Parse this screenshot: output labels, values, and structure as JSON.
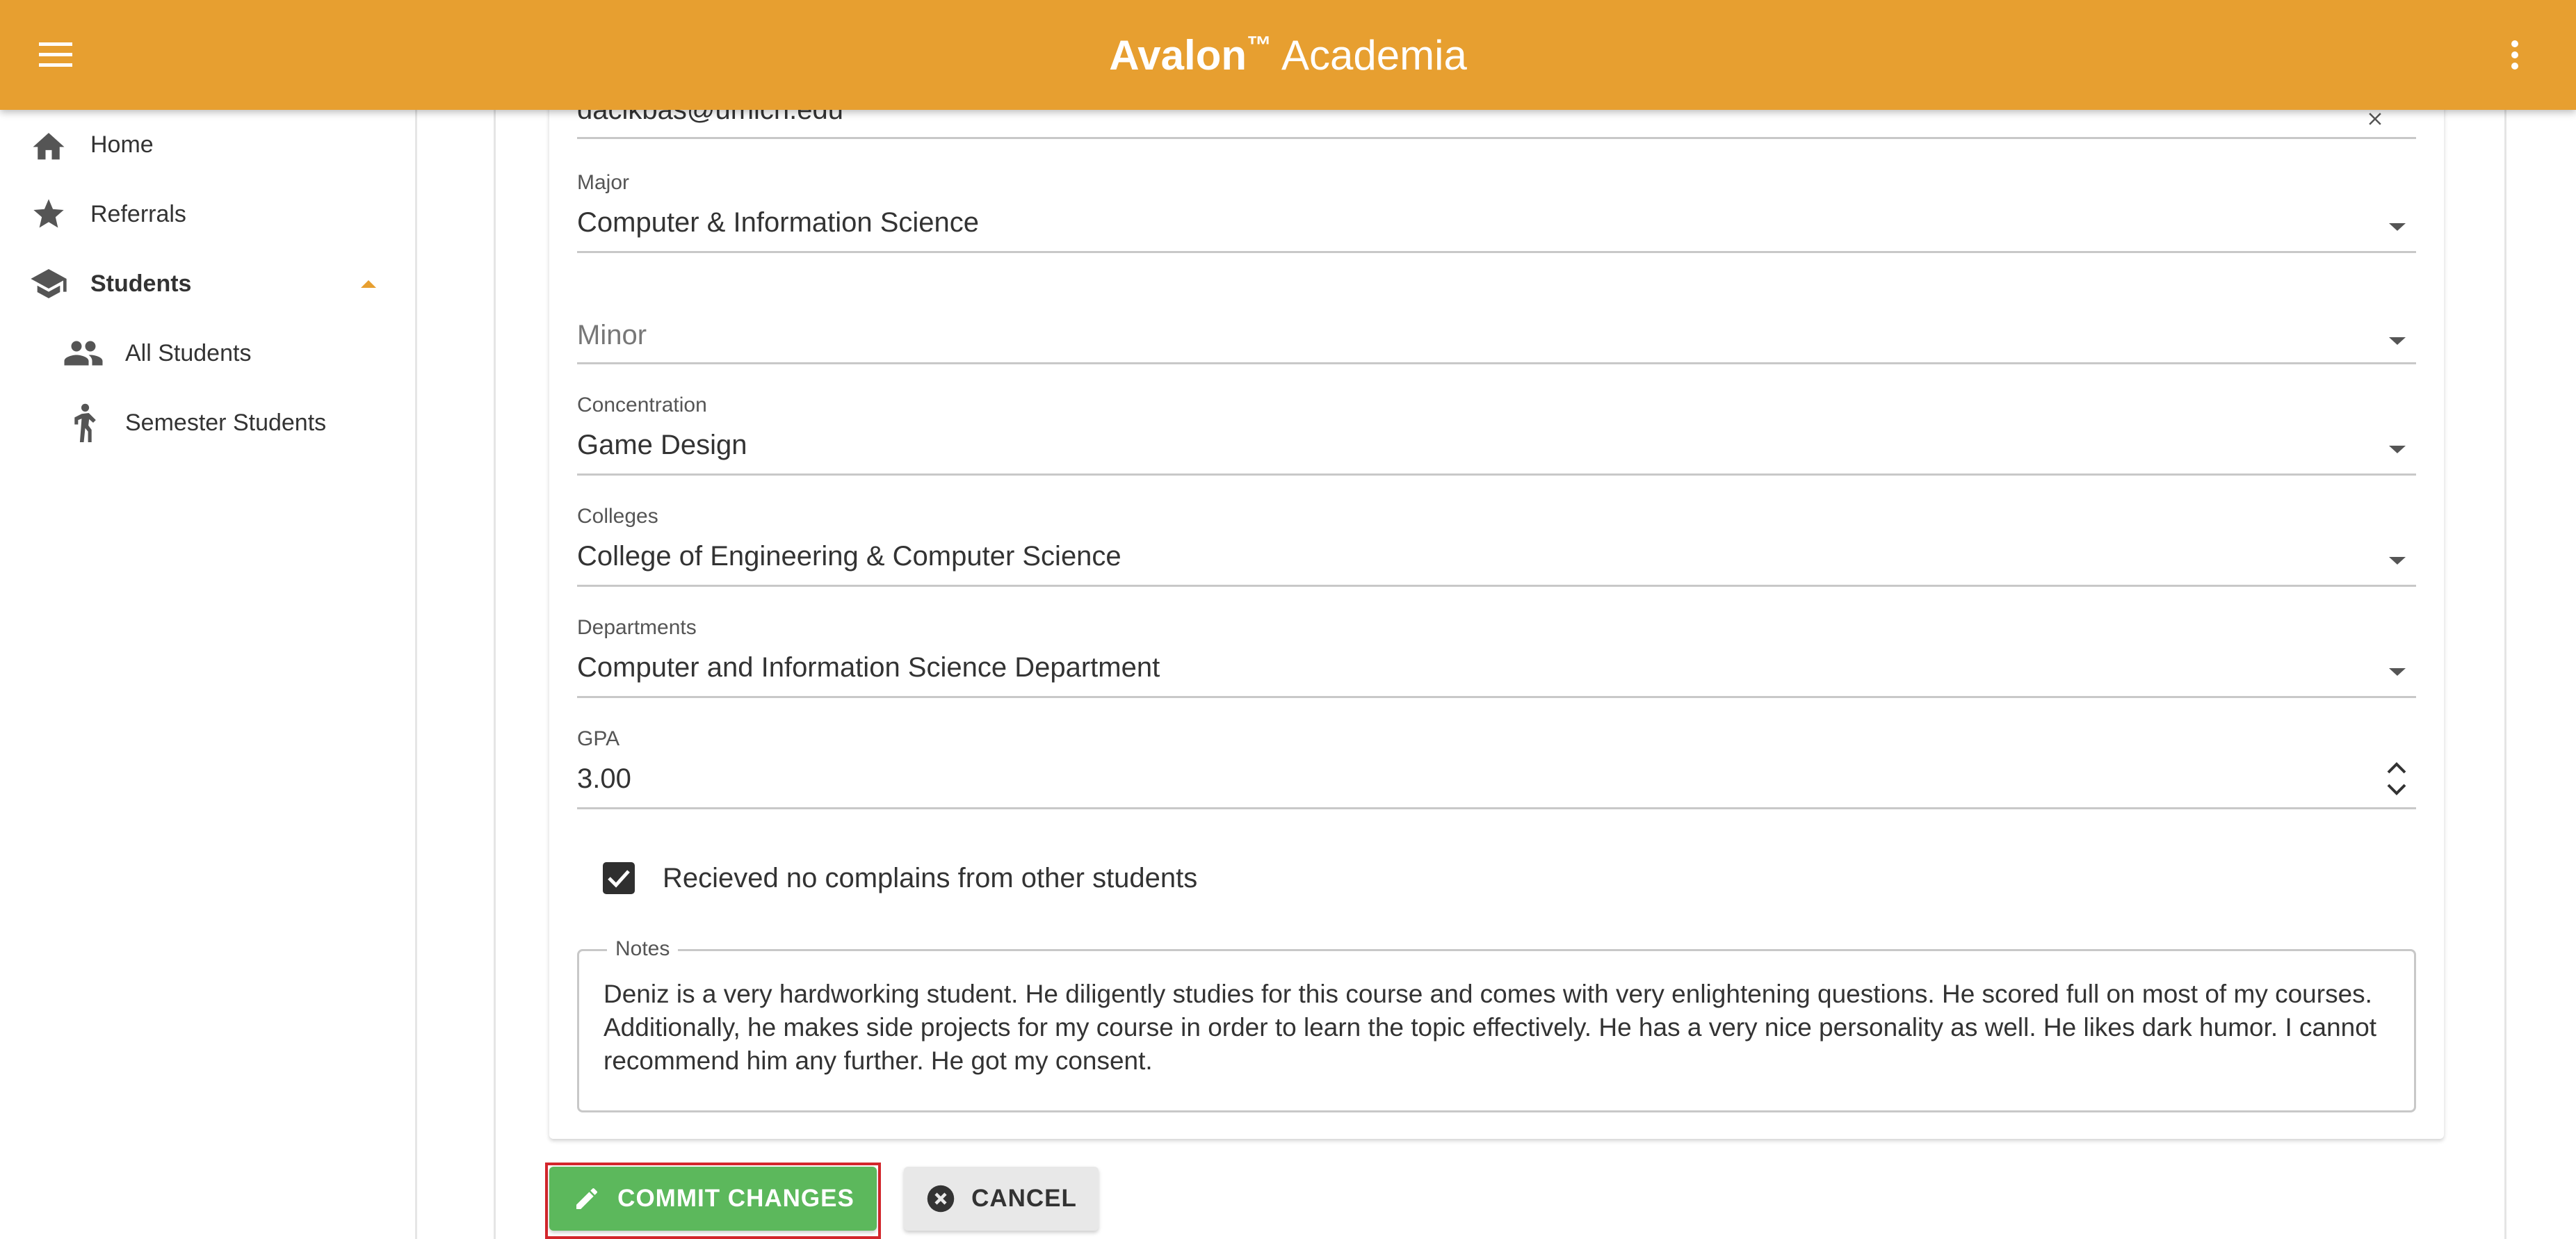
{
  "header": {
    "brand_bold": "Avalon",
    "brand_tm": "™",
    "brand_rest": "Academia",
    "background": "#E79F30",
    "menu_icon": "hamburger-menu-icon",
    "more_icon": "more-vert-icon"
  },
  "sidebar": {
    "items": [
      {
        "label": "Home",
        "icon": "home-icon"
      },
      {
        "label": "Referrals",
        "icon": "star-icon"
      },
      {
        "label": "Students",
        "icon": "school-icon",
        "expanded": true
      },
      {
        "label": "All Students",
        "icon": "people-icon"
      },
      {
        "label": "Semester Students",
        "icon": "person-walking-icon"
      }
    ]
  },
  "form": {
    "email": {
      "value": "dacikbas@umich.edu"
    },
    "major": {
      "label": "Major",
      "value": "Computer & Information Science"
    },
    "minor": {
      "placeholder": "Minor"
    },
    "concentration": {
      "label": "Concentration",
      "value": "Game Design"
    },
    "colleges": {
      "label": "Colleges",
      "value": "College of Engineering & Computer Science"
    },
    "departments": {
      "label": "Departments",
      "value": "Computer and Information Science Department"
    },
    "gpa": {
      "label": "GPA",
      "value": "3.00"
    },
    "no_complaints": {
      "label": "Recieved no complains from other students",
      "checked": true
    },
    "notes": {
      "label": "Notes",
      "value": "Deniz is a very hardworking student. He diligently studies for this course and comes with very enlightening questions. He scored full on most of my courses. Additionally, he makes side projects for my course in order to learn the topic effectively. He has a very nice personality as well. He likes dark humor. I cannot recommend him any further. He got my consent."
    }
  },
  "actions": {
    "commit_label": "COMMIT CHANGES",
    "cancel_label": "CANCEL",
    "commit_color": "#5cb85c",
    "highlight_color": "#d3262c"
  }
}
